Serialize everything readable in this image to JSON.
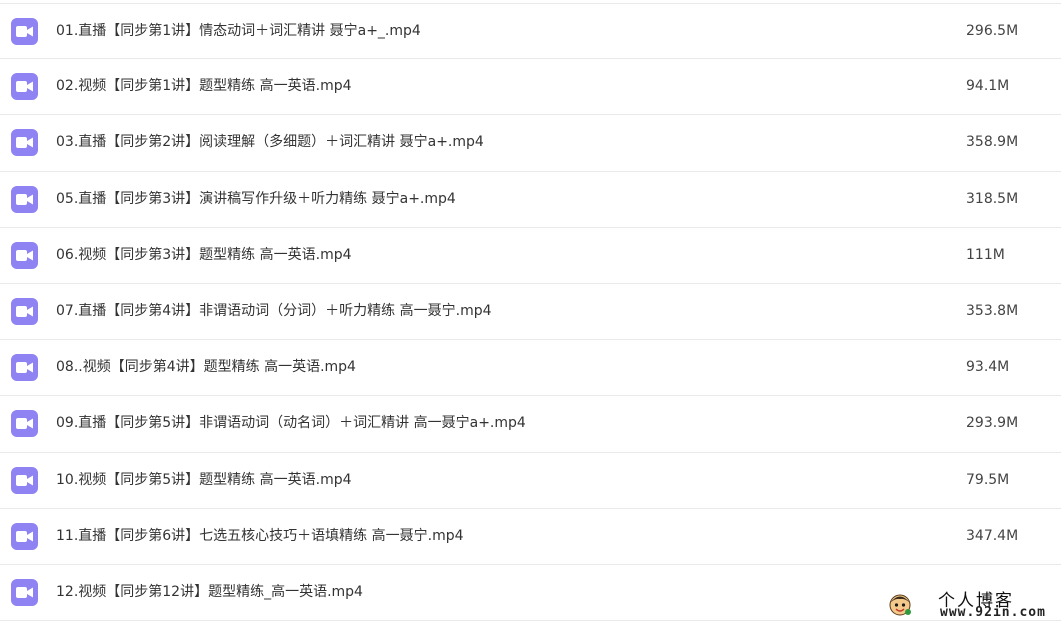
{
  "files": [
    {
      "name": "01.直播【同步第1讲】情态动词＋词汇精讲 聂宁a+_.mp4",
      "size": "296.5M",
      "icon": "video-file-icon"
    },
    {
      "name": "02.视频【同步第1讲】题型精练 高一英语.mp4",
      "size": "94.1M",
      "icon": "video-file-icon"
    },
    {
      "name": "03.直播【同步第2讲】阅读理解（多细题）＋词汇精讲 聂宁a+.mp4",
      "size": "358.9M",
      "icon": "video-file-icon"
    },
    {
      "name": "05.直播【同步第3讲】演讲稿写作升级＋听力精练 聂宁a+.mp4",
      "size": "318.5M",
      "icon": "video-file-icon"
    },
    {
      "name": "06.视频【同步第3讲】题型精练 高一英语.mp4",
      "size": "111M",
      "icon": "video-file-icon"
    },
    {
      "name": "07.直播【同步第4讲】非谓语动词（分词）＋听力精练 高一聂宁.mp4",
      "size": "353.8M",
      "icon": "video-file-icon"
    },
    {
      "name": "08..视频【同步第4讲】题型精练 高一英语.mp4",
      "size": "93.4M",
      "icon": "video-file-icon"
    },
    {
      "name": "09.直播【同步第5讲】非谓语动词（动名词）＋词汇精讲 高一聂宁a+.mp4",
      "size": "293.9M",
      "icon": "video-file-icon"
    },
    {
      "name": "10.视频【同步第5讲】题型精练 高一英语.mp4",
      "size": "79.5M",
      "icon": "video-file-icon"
    },
    {
      "name": "11.直播【同步第6讲】七选五核心技巧＋语填精练 高一聂宁.mp4",
      "size": "347.4M",
      "icon": "video-file-icon"
    },
    {
      "name": "12.视频【同步第12讲】题型精练_高一英语.mp4",
      "size": "",
      "icon": "video-file-icon"
    }
  ],
  "watermark": {
    "title": "个人博客",
    "url": "www.92in.com"
  },
  "colors": {
    "icon_bg": "#8f82f2",
    "divider": "#e9e9ec",
    "text": "#333333"
  }
}
